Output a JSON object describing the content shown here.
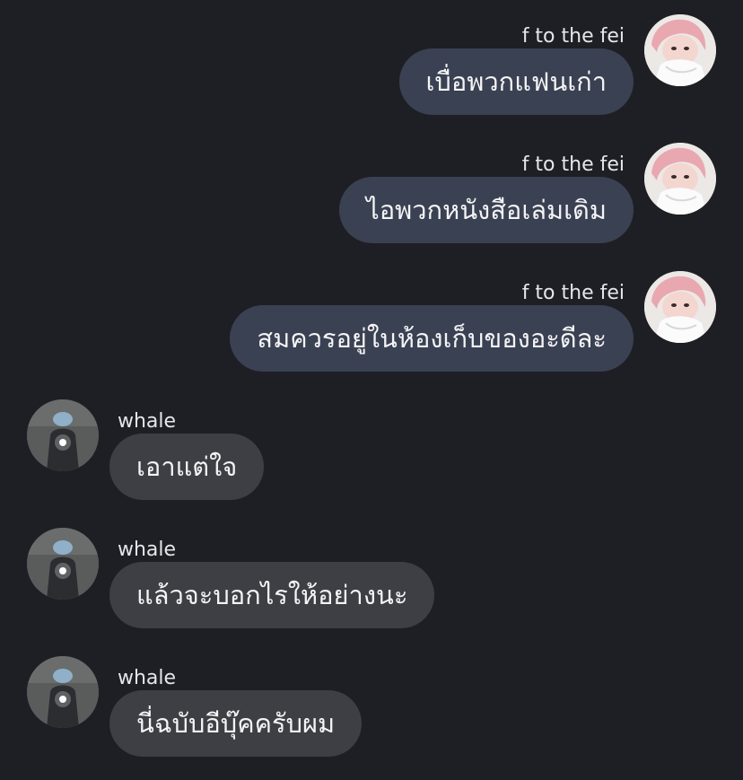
{
  "messages": [
    {
      "sender": "f to the fei",
      "direction": "out",
      "text": "เบื่อพวกแฟนเก่า",
      "avatar": "pink-hair-avatar"
    },
    {
      "sender": "f to the fei",
      "direction": "out",
      "text": "ไอพวกหนังสือเล่มเดิม",
      "avatar": "pink-hair-avatar"
    },
    {
      "sender": "f to the fei",
      "direction": "out",
      "text": "สมควรอยู่ในห้องเก็บของอะดีละ",
      "avatar": "pink-hair-avatar"
    },
    {
      "sender": "whale",
      "direction": "in",
      "text": "เอาแต่ใจ",
      "avatar": "mirror-selfie-avatar"
    },
    {
      "sender": "whale",
      "direction": "in",
      "text": "แล้วจะบอกไรให้อย่างนะ",
      "avatar": "mirror-selfie-avatar"
    },
    {
      "sender": "whale",
      "direction": "in",
      "text": "นี่ฉบับอีบุ๊คครับผม",
      "avatar": "mirror-selfie-avatar"
    }
  ],
  "colors": {
    "background": "#1e1f24",
    "outgoing_bubble": "#3a4152",
    "incoming_bubble": "#3e3f44",
    "text": "#f4f4f6"
  }
}
